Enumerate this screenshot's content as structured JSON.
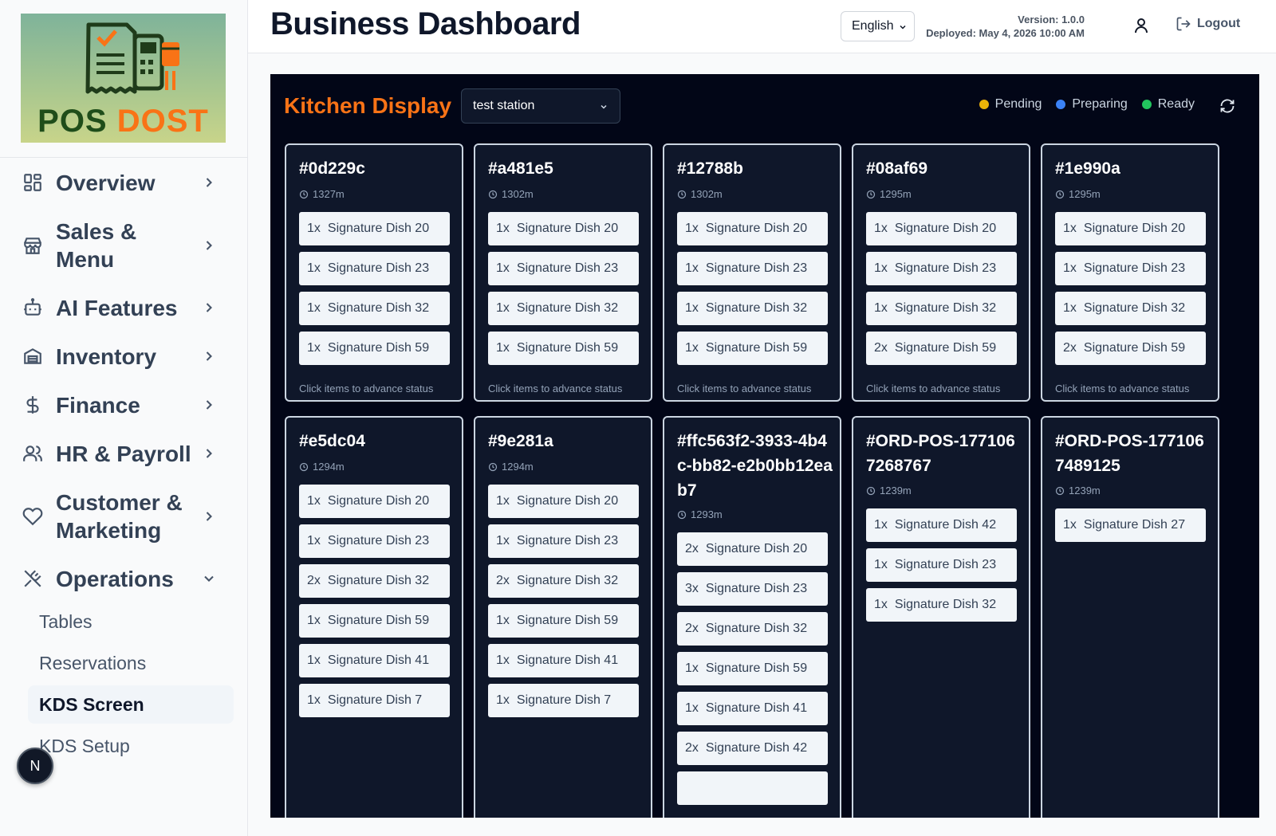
{
  "app": {
    "logo_text_1": "POS ",
    "logo_text_2": "DOST"
  },
  "sidebar": {
    "items": [
      {
        "label": "Overview",
        "icon": "grid-icon"
      },
      {
        "label": "Sales & Menu",
        "icon": "store-icon"
      },
      {
        "label": "AI Features",
        "icon": "robot-icon"
      },
      {
        "label": "Inventory",
        "icon": "warehouse-icon"
      },
      {
        "label": "Finance",
        "icon": "dollar-icon"
      },
      {
        "label": "HR & Payroll",
        "icon": "users-icon"
      },
      {
        "label": "Customer & Marketing",
        "icon": "heart-icon"
      },
      {
        "label": "Operations",
        "icon": "utensils-crossed-icon"
      }
    ],
    "sub_items": [
      "Tables",
      "Reservations",
      "KDS Screen",
      "KDS Setup"
    ],
    "badge": "N"
  },
  "header": {
    "title": "Business Dashboard",
    "language": "English",
    "version": "Version: 1.0.0",
    "deployed": "Deployed: May 4, 2026 10:00 AM",
    "logout": "Logout"
  },
  "kds": {
    "title": "Kitchen Display",
    "station": "test station",
    "legend": [
      {
        "label": "Pending",
        "color": "#eab308"
      },
      {
        "label": "Preparing",
        "color": "#3b82f6"
      },
      {
        "label": "Ready",
        "color": "#22c55e"
      }
    ],
    "hint": "Click items to advance status",
    "orders": [
      {
        "id": "#0d229c",
        "time": "1327m",
        "items": [
          [
            "1x",
            "Signature Dish 20"
          ],
          [
            "1x",
            "Signature Dish 23"
          ],
          [
            "1x",
            "Signature Dish 32"
          ],
          [
            "1x",
            "Signature Dish 59"
          ]
        ],
        "hint": true
      },
      {
        "id": "#a481e5",
        "time": "1302m",
        "items": [
          [
            "1x",
            "Signature Dish 20"
          ],
          [
            "1x",
            "Signature Dish 23"
          ],
          [
            "1x",
            "Signature Dish 32"
          ],
          [
            "1x",
            "Signature Dish 59"
          ]
        ],
        "hint": true
      },
      {
        "id": "#12788b",
        "time": "1302m",
        "items": [
          [
            "1x",
            "Signature Dish 20"
          ],
          [
            "1x",
            "Signature Dish 23"
          ],
          [
            "1x",
            "Signature Dish 32"
          ],
          [
            "1x",
            "Signature Dish 59"
          ]
        ],
        "hint": true
      },
      {
        "id": "#08af69",
        "time": "1295m",
        "items": [
          [
            "1x",
            "Signature Dish 20"
          ],
          [
            "1x",
            "Signature Dish 23"
          ],
          [
            "1x",
            "Signature Dish 32"
          ],
          [
            "2x",
            "Signature Dish 59"
          ]
        ],
        "hint": true
      },
      {
        "id": "#1e990a",
        "time": "1295m",
        "items": [
          [
            "1x",
            "Signature Dish 20"
          ],
          [
            "1x",
            "Signature Dish 23"
          ],
          [
            "1x",
            "Signature Dish 32"
          ],
          [
            "2x",
            "Signature Dish 59"
          ]
        ],
        "hint": true
      },
      {
        "id": "#e5dc04",
        "time": "1294m",
        "items": [
          [
            "1x",
            "Signature Dish 20"
          ],
          [
            "1x",
            "Signature Dish 23"
          ],
          [
            "2x",
            "Signature Dish 32"
          ],
          [
            "1x",
            "Signature Dish 59"
          ],
          [
            "1x",
            "Signature Dish 41"
          ],
          [
            "1x",
            "Signature Dish 7"
          ]
        ],
        "hint": false
      },
      {
        "id": "#9e281a",
        "time": "1294m",
        "items": [
          [
            "1x",
            "Signature Dish 20"
          ],
          [
            "1x",
            "Signature Dish 23"
          ],
          [
            "2x",
            "Signature Dish 32"
          ],
          [
            "1x",
            "Signature Dish 59"
          ],
          [
            "1x",
            "Signature Dish 41"
          ],
          [
            "1x",
            "Signature Dish 7"
          ]
        ],
        "hint": false
      },
      {
        "id": "#ffc563f2-3933-4b4c-bb82-e2b0bb12eab7",
        "time": "1293m",
        "items": [
          [
            "2x",
            "Signature Dish 20"
          ],
          [
            "3x",
            "Signature Dish 23"
          ],
          [
            "2x",
            "Signature Dish 32"
          ],
          [
            "1x",
            "Signature Dish 59"
          ],
          [
            "1x",
            "Signature Dish 41"
          ],
          [
            "2x",
            "Signature Dish 42"
          ],
          [
            "",
            ""
          ]
        ],
        "hint": false
      },
      {
        "id": "#ORD-POS-1771067268767",
        "time": "1239m",
        "items": [
          [
            "1x",
            "Signature Dish 42"
          ],
          [
            "1x",
            "Signature Dish 23"
          ],
          [
            "1x",
            "Signature Dish 32"
          ]
        ],
        "hint": false
      },
      {
        "id": "#ORD-POS-1771067489125",
        "time": "1239m",
        "items": [
          [
            "1x",
            "Signature Dish 27"
          ]
        ],
        "hint": false
      }
    ]
  }
}
